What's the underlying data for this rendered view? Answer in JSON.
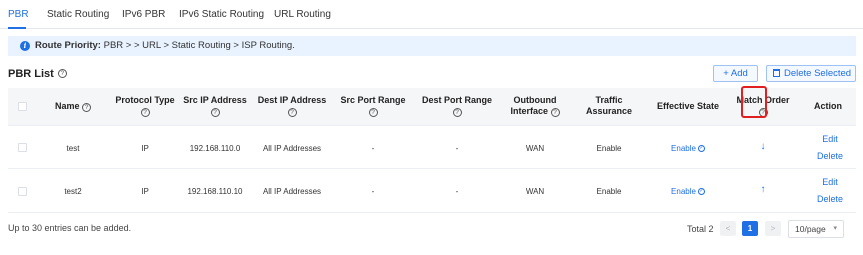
{
  "tabs": [
    {
      "label": "PBR",
      "active": true
    },
    {
      "label": "Static Routing"
    },
    {
      "label": "IPv6 PBR"
    },
    {
      "label": "IPv6 Static Routing"
    },
    {
      "label": "URL Routing"
    }
  ],
  "banner": {
    "icon": "info-icon",
    "title": "Route Priority:",
    "text": " PBR > > URL > Static Routing > ISP Routing."
  },
  "list": {
    "title": "PBR List",
    "add_label": "+ Add",
    "delete_label": "Delete Selected"
  },
  "table": {
    "columns": {
      "name": "Name",
      "protocol": "Protocol Type",
      "src_ip": "Src IP Address",
      "dest_ip": "Dest IP Address",
      "src_port": "Src Port Range",
      "dest_port": "Dest Port Range",
      "outbound_1": "Outbound",
      "outbound_2": "Interface",
      "traffic_1": "Traffic",
      "traffic_2": "Assurance",
      "state": "Effective State",
      "order": "Match Order",
      "action": "Action"
    },
    "help_glyph": "?",
    "rows": [
      {
        "name": "test",
        "protocol": "IP",
        "src_ip": "192.168.110.0",
        "dest_ip": "All IP Addresses",
        "src_port": "-",
        "dest_port": "-",
        "outbound": "WAN",
        "traffic": "Enable",
        "state": "Enable",
        "order_arrow": "↓",
        "edit": "Edit",
        "delete": "Delete"
      },
      {
        "name": "test2",
        "protocol": "IP",
        "src_ip": "192.168.110.10",
        "dest_ip": "All IP Addresses",
        "src_port": "-",
        "dest_port": "-",
        "outbound": "WAN",
        "traffic": "Enable",
        "state": "Enable",
        "order_arrow": "↑",
        "edit": "Edit",
        "delete": "Delete"
      }
    ]
  },
  "footer": {
    "note": "Up to 30 entries can be added.",
    "total": "Total 2",
    "prev": "<",
    "page": "1",
    "next": ">",
    "page_size": "10/page"
  },
  "colors": {
    "accent": "#1f6fe5",
    "highlight": "#e02020",
    "banner_bg": "#e8f3ff"
  }
}
